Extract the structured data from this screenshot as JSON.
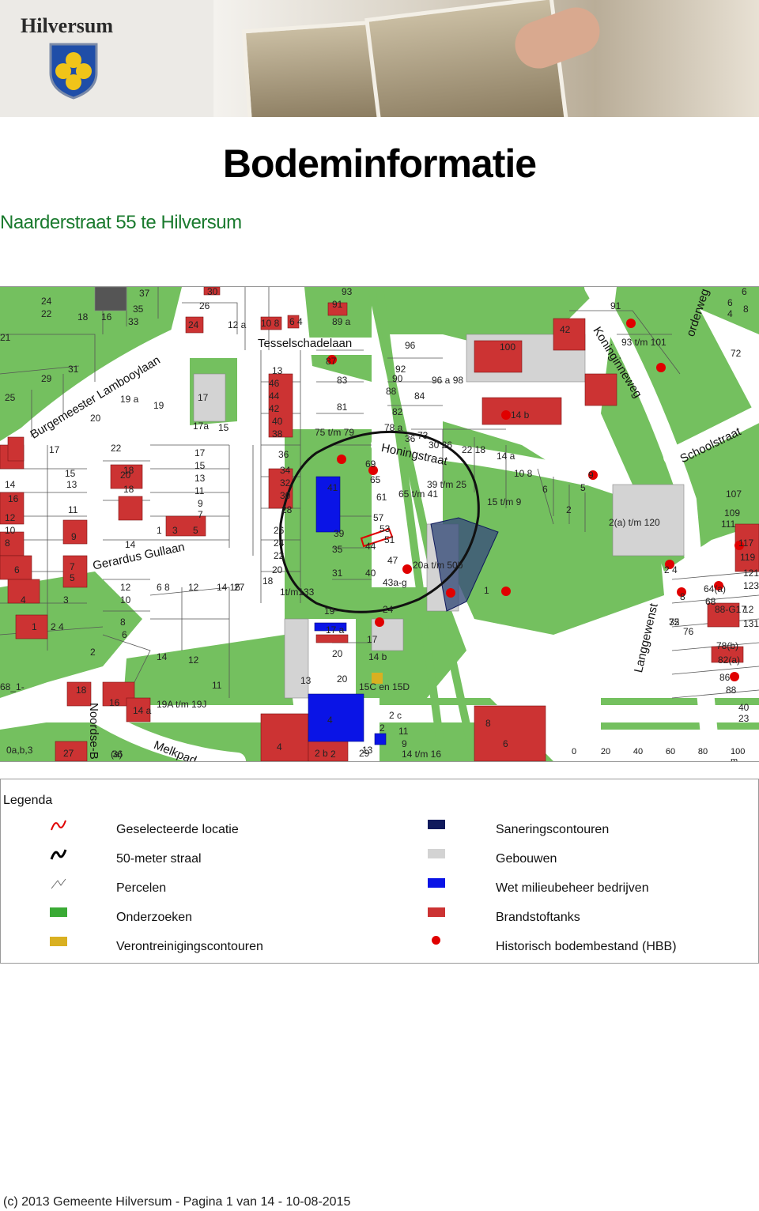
{
  "header": {
    "logo_text": "Hilversum",
    "title": "Bodeminformatie",
    "subtitle": "Naarderstraat 55 te Hilversum"
  },
  "map": {
    "street_names": {
      "burgemeester": "Burgemeester Lambooylaan",
      "tesselschade": "Tesselschadelaan",
      "koninginneweg": "Koninginneweg",
      "schoolstraat": "Schoolstraat",
      "honingstraat": "Honingstraat",
      "gerardus": "Gerardus Gullaan",
      "langgewenst": "Langgewenst",
      "melkpad": "Melkpad",
      "noordse": "Noordse-B",
      "orderweg": "orderweg"
    },
    "house_numbers": [
      "24",
      "22",
      "18",
      "16",
      "37",
      "35",
      "33",
      "30",
      "26",
      "24",
      "12 a",
      "10 8",
      "6 4",
      "93",
      "91",
      "89 a",
      "21",
      "29",
      "31",
      "25",
      "19 a",
      "19",
      "17",
      "17a",
      "15",
      "13",
      "46",
      "44",
      "42",
      "40",
      "38",
      "87",
      "83",
      "81",
      "75 t/m 79",
      "96",
      "92",
      "90",
      "88",
      "82",
      "84",
      "96 a 98",
      "100",
      "42",
      "91",
      "93 t/m 101",
      "14 b",
      "78 a",
      "73",
      "36",
      "30 26",
      "22 18",
      "14 a",
      "10 8",
      "6",
      "9",
      "5",
      "2",
      "20",
      "18",
      "17",
      "22",
      "15",
      "13",
      "11",
      "20",
      "18",
      "17",
      "15",
      "13",
      "11",
      "9",
      "7",
      "36",
      "34",
      "32",
      "30",
      "28",
      "69",
      "65",
      "61",
      "39 t/m 25",
      "65 t/m 41",
      "15 t/m 9",
      "14",
      "16",
      "12",
      "10",
      "8",
      "9",
      "41",
      "57",
      "53",
      "51",
      "39",
      "26",
      "24",
      "22",
      "20",
      "18",
      "35",
      "44",
      "47",
      "31",
      "40",
      "43a-g",
      "20a t/m 50b",
      "2(a) t/m 120",
      "107",
      "109",
      "111",
      "117",
      "119",
      "6",
      "7",
      "5",
      "14",
      "1",
      "3",
      "5",
      "12",
      "10",
      "4",
      "3",
      "8",
      "6",
      "2",
      "1",
      "2 4",
      "6 8",
      "12",
      "14 16",
      "27",
      "36",
      "1t/m133",
      "1",
      "2 4",
      "8",
      "64(a)",
      "68",
      "88-G17",
      "72",
      "76",
      "78(b)",
      "82(a)",
      "86",
      "88",
      "40",
      "23",
      "35",
      "19",
      "24",
      "17 a",
      "17",
      "20",
      "14 b",
      "14",
      "12",
      "11",
      "13",
      "20",
      "18",
      "16",
      "14 a",
      "19A t/m 19J",
      "15C en 15D",
      "2 c",
      "4",
      "2",
      "13",
      "11",
      "9",
      "14 t/m 16",
      "8",
      "6",
      "4",
      "2 b",
      "2",
      "29",
      "27",
      "(a)",
      "0a,b,3",
      "68_1-",
      "72",
      "4",
      "6",
      "8",
      "6",
      "121",
      "123",
      "131",
      "12"
    ],
    "scale": {
      "ticks": [
        "0",
        "20",
        "40",
        "60",
        "80",
        "100 m"
      ]
    }
  },
  "legend": {
    "title": "Legenda",
    "items_left": [
      {
        "label": "Geselecteerde locatie",
        "symbol": "red-line-icon"
      },
      {
        "label": "50-meter straal",
        "symbol": "black-line-icon"
      },
      {
        "label": "Percelen",
        "symbol": "thin-line-icon"
      },
      {
        "label": "Onderzoeken",
        "symbol": "green-swatch",
        "color": "#3aaa35"
      },
      {
        "label": "Verontreinigingscontouren",
        "symbol": "yellow-swatch",
        "color": "#d9b021"
      }
    ],
    "items_right": [
      {
        "label": "Saneringscontouren",
        "symbol": "navy-swatch",
        "color": "#101a5c"
      },
      {
        "label": "Gebouwen",
        "symbol": "grey-swatch",
        "color": "#d3d3d3"
      },
      {
        "label": "Wet milieubeheer bedrijven",
        "symbol": "blue-swatch",
        "color": "#0a14e6"
      },
      {
        "label": "Brandstoftanks",
        "symbol": "red-swatch",
        "color": "#cc3333"
      },
      {
        "label": "Historisch bodembestand (HBB)",
        "symbol": "red-dot-icon",
        "color": "#e00000"
      }
    ]
  },
  "footer": {
    "text": "(c) 2013 Gemeente Hilversum - Pagina 1 van 14 - 10-08-2015"
  },
  "colors": {
    "green": "#74c05f",
    "brand_green": "#1a7a2e",
    "tank_red": "#cc3333",
    "hbb_red": "#e00000",
    "wm_blue": "#0a14e6",
    "sanering": "#101a5c",
    "building": "#d3d3d3"
  }
}
